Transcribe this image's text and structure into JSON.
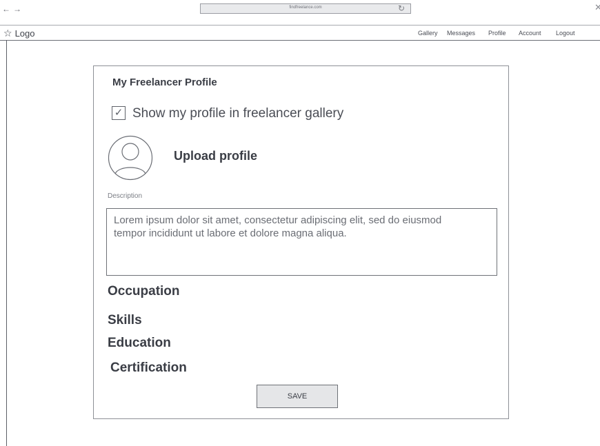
{
  "browser": {
    "back_icon": "left-arrow-icon",
    "forward_icon": "right-arrow-icon",
    "url": "findfreelance.com",
    "reload_icon": "reload-icon",
    "close_icon": "close-icon"
  },
  "header": {
    "logo_text": "Logo",
    "nav": [
      "Gallery",
      "Messages",
      "Profile",
      "Account",
      "Logout"
    ]
  },
  "profile": {
    "title": "My Freelancer Profile",
    "show_in_gallery_checked": true,
    "show_in_gallery_label": "Show my profile in freelancer gallery",
    "upload_label": "Upload profile",
    "description_label": "Description",
    "description_text": "Lorem ipsum dolor sit amet, consectetur adipiscing elit, sed do eiusmod\ntempor incididunt ut labore et dolore magna aliqua.",
    "sections": [
      "Occupation",
      "Skills",
      "Education",
      "Certification"
    ],
    "save_label": "SAVE"
  },
  "colors": {
    "border": "#8d8f95",
    "text": "#3a3d45",
    "button_bg": "#e5e6e8"
  }
}
